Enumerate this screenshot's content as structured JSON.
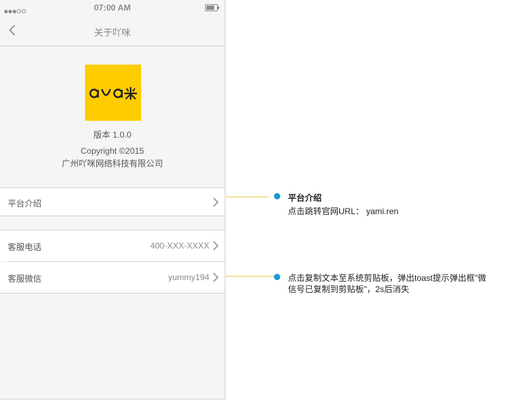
{
  "status_bar": {
    "time": "07:00 AM"
  },
  "nav": {
    "title": "关于吖咪"
  },
  "logo_text": "aYa米",
  "info": {
    "version": "版本 1.0.0",
    "copyright": "Copyright ©2015",
    "company": "广州吖咪网络科技有限公司"
  },
  "rows": {
    "intro": {
      "label": "平台介绍"
    },
    "phone": {
      "label": "客服电话",
      "value": "400-XXX-XXXX"
    },
    "wechat": {
      "label": "客服微信",
      "value": "yummy194"
    }
  },
  "annotations": {
    "intro_title": "平台介绍",
    "intro_desc": "点击跳转官网URL：  yami.ren",
    "wechat_desc_line1": "点击复制文本至系统剪贴板，弹出toast提示弹出框\"微",
    "wechat_desc_line2": "信号已复制到剪贴板\"，2s后消失"
  },
  "colors": {
    "logo_bg": "#ffcc00",
    "annotation_dot": "#1a9ad6",
    "connector": "#e8c84a"
  }
}
